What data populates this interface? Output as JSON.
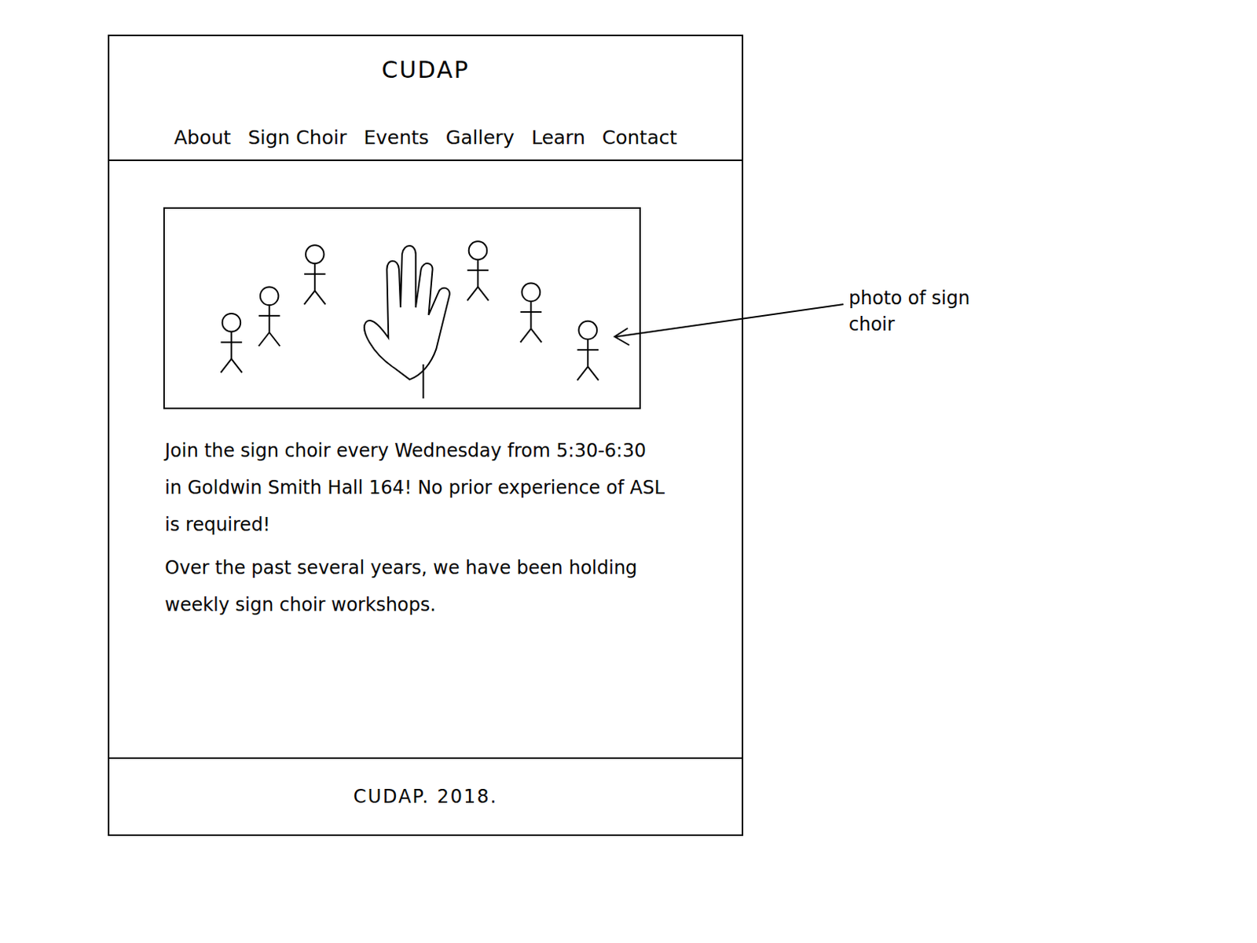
{
  "header": {
    "title": "CUDAP"
  },
  "nav": [
    {
      "label": "About"
    },
    {
      "label": "Sign Choir"
    },
    {
      "label": "Events"
    },
    {
      "label": "Gallery"
    },
    {
      "label": "Learn"
    },
    {
      "label": "Contact"
    }
  ],
  "content": {
    "paragraphs": [
      "Join the sign choir every Wednesday from 5:30-6:30 in Goldwin Smith Hall 164! No prior experience of ASL is required!",
      "Over the past several years, we have been holding weekly sign choir workshops."
    ]
  },
  "annotation": {
    "text": "photo of sign choir"
  },
  "footer": {
    "text": "CUDAP. 2018."
  }
}
